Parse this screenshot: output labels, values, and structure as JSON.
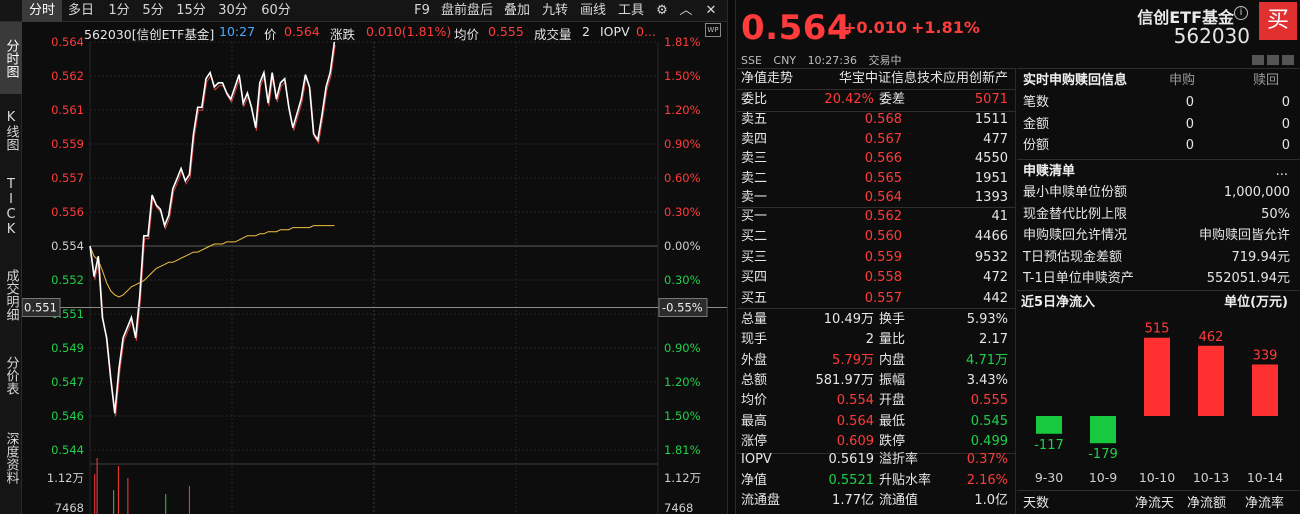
{
  "toolbar": {
    "tabs": [
      "分时",
      "多日",
      "1分",
      "5分",
      "15分",
      "30分",
      "60分"
    ],
    "right_items": [
      "F9",
      "盘前盘后",
      "叠加",
      "九转",
      "画线",
      "工具"
    ]
  },
  "vtabs": [
    "分时图",
    "K线图",
    "TICK",
    "成交明细",
    "分价表",
    "深度资料"
  ],
  "chart": {
    "code_name": "562030[信创ETF基金]",
    "time": "10:27",
    "price_label": "价",
    "price": "0.564",
    "change_label": "涨跌",
    "change": "0.010(1.81%)",
    "avg_label": "均价",
    "avg": "0.555",
    "vol_label": "成交量",
    "vol": "2",
    "iopv_label": "IOPV",
    "iopv": "0...",
    "wp": "WP",
    "y_left": [
      "0.564",
      "0.562",
      "0.561",
      "0.559",
      "0.557",
      "0.556",
      "0.554",
      "0.552",
      "0.551",
      "0.549",
      "0.547",
      "0.546",
      "0.544"
    ],
    "y_right": [
      "1.81%",
      "1.50%",
      "1.20%",
      "0.90%",
      "0.60%",
      "0.30%",
      "0.00%",
      "0.30%",
      "",
      "0.90%",
      "1.20%",
      "1.50%",
      "1.81%"
    ],
    "crosshair_left": "0.551",
    "crosshair_right": "-0.55%",
    "vol_left": [
      "1.12万",
      "7468"
    ],
    "vol_right": [
      "1.12万",
      "7468"
    ],
    "colors": {
      "price_line": "#ffffff",
      "avg_line": "#f0c040",
      "up": "#ff3b3b",
      "down": "#1fd14a"
    }
  },
  "chart_data": {
    "type": "line",
    "x": [
      0,
      1,
      2,
      3,
      4,
      5,
      6,
      7,
      8,
      9,
      10,
      11,
      12,
      13,
      14,
      15,
      16,
      17,
      18,
      19,
      20,
      21,
      22,
      23,
      24,
      25,
      26,
      27,
      28,
      29,
      30,
      31,
      32,
      33,
      34,
      35,
      36,
      37,
      38,
      39,
      40,
      41,
      42,
      43,
      44,
      45,
      46,
      47,
      48,
      49,
      50,
      51,
      52,
      53,
      54,
      55,
      56,
      57,
      58,
      59,
      60,
      61,
      62,
      63,
      64
    ],
    "series": [
      {
        "values": [
          0.554,
          0.5525,
          0.5535,
          0.5505,
          0.5495,
          0.5475,
          0.5458,
          0.548,
          0.5495,
          0.55,
          0.5505,
          0.5495,
          0.5515,
          0.5545,
          0.5545,
          0.5565,
          0.556,
          0.5558,
          0.555,
          0.5555,
          0.5568,
          0.5573,
          0.5578,
          0.5572,
          0.5575,
          0.5595,
          0.5608,
          0.5608,
          0.5622,
          0.5625,
          0.5618,
          0.562,
          0.562,
          0.5615,
          0.5612,
          0.5618,
          0.5624,
          0.561,
          0.5615,
          0.5608,
          0.5598,
          0.562,
          0.5625,
          0.561,
          0.5625,
          0.5612,
          0.562,
          0.5622,
          0.5608,
          0.5598,
          0.5605,
          0.5612,
          0.5624,
          0.5618,
          0.5595,
          0.5592,
          0.5604,
          0.5618,
          0.5625,
          0.564
        ]
      },
      {
        "values": [
          0.554,
          0.5535,
          0.5533,
          0.5528,
          0.5522,
          0.5518,
          0.5516,
          0.5515,
          0.5516,
          0.5518,
          0.552,
          0.5521,
          0.5522,
          0.5523,
          0.5525,
          0.5527,
          0.5529,
          0.553,
          0.5531,
          0.5532,
          0.5532,
          0.5533,
          0.5534,
          0.5535,
          0.5536,
          0.5537,
          0.5537,
          0.5538,
          0.5539,
          0.554,
          0.5541,
          0.5541,
          0.5541,
          0.5542,
          0.5542,
          0.5542,
          0.5543,
          0.5544,
          0.5545,
          0.5545,
          0.5545,
          0.5546,
          0.5546,
          0.5547,
          0.5547,
          0.5547,
          0.5548,
          0.5548,
          0.5548,
          0.5549,
          0.5549,
          0.5549,
          0.5549,
          0.5549,
          0.555,
          0.555,
          0.555,
          0.555,
          0.555,
          0.555
        ]
      }
    ],
    "ylim": [
      0.544,
      0.564
    ],
    "grid": true
  },
  "quote": {
    "price": "0.564",
    "change": "+0.010",
    "change_pct": "+1.81%",
    "exchange": "SSE",
    "currency": "CNY",
    "time": "10:27:36",
    "status": "交易中",
    "name": "信创ETF基金",
    "info": "i",
    "code": "562030",
    "buy": "买"
  },
  "book": {
    "nav_trend_label": "净值走势",
    "index_name": "华宝中证信息技术应用创新产",
    "weibi_label": "委比",
    "weibi": "20.42%",
    "weicha_label": "委差",
    "weicha": "5071",
    "asks": [
      {
        "label": "卖五",
        "price": "0.568",
        "vol": "1511"
      },
      {
        "label": "卖四",
        "price": "0.567",
        "vol": "477"
      },
      {
        "label": "卖三",
        "price": "0.566",
        "vol": "4550"
      },
      {
        "label": "卖二",
        "price": "0.565",
        "vol": "1951"
      },
      {
        "label": "卖一",
        "price": "0.564",
        "vol": "1393"
      }
    ],
    "bids": [
      {
        "label": "买一",
        "price": "0.562",
        "vol": "41"
      },
      {
        "label": "买二",
        "price": "0.560",
        "vol": "4466"
      },
      {
        "label": "买三",
        "price": "0.559",
        "vol": "9532"
      },
      {
        "label": "买四",
        "price": "0.558",
        "vol": "472"
      },
      {
        "label": "买五",
        "price": "0.557",
        "vol": "442"
      }
    ],
    "stats": [
      {
        "l1": "总量",
        "v1": "10.49万",
        "c1": "white",
        "l2": "换手",
        "v2": "5.93%",
        "c2": "white"
      },
      {
        "l1": "现手",
        "v1": "2",
        "c1": "white",
        "l2": "量比",
        "v2": "2.17",
        "c2": "white"
      },
      {
        "l1": "外盘",
        "v1": "5.79万",
        "c1": "red",
        "l2": "内盘",
        "v2": "4.71万",
        "c2": "green"
      },
      {
        "l1": "总额",
        "v1": "581.97万",
        "c1": "white",
        "l2": "振幅",
        "v2": "3.43%",
        "c2": "white"
      },
      {
        "l1": "均价",
        "v1": "0.554",
        "c1": "red",
        "l2": "开盘",
        "v2": "0.555",
        "c2": "red"
      },
      {
        "l1": "最高",
        "v1": "0.564",
        "c1": "red",
        "l2": "最低",
        "v2": "0.545",
        "c2": "green"
      },
      {
        "l1": "涨停",
        "v1": "0.609",
        "c1": "red",
        "l2": "跌停",
        "v2": "0.499",
        "c2": "green"
      }
    ],
    "stats2": [
      {
        "l1": "IOPV",
        "v1": "0.5619",
        "c1": "white",
        "l2": "溢折率",
        "v2": "0.37%",
        "c2": "red"
      },
      {
        "l1": "净值",
        "v1": "0.5521",
        "c1": "green",
        "l2": "升贴水率",
        "v2": "2.16%",
        "c2": "red"
      },
      {
        "l1": "流通盘",
        "v1": "1.77亿",
        "c1": "white",
        "l2": "流通值",
        "v2": "1.0亿",
        "c2": "white"
      }
    ]
  },
  "side": {
    "redeem_title": "实时申购赎回信息",
    "col_sub": "申购",
    "col_red": "赎回",
    "redeem_rows": [
      {
        "label": "笔数",
        "sub": "0",
        "red": "0"
      },
      {
        "label": "金额",
        "sub": "0",
        "red": "0"
      },
      {
        "label": "份额",
        "sub": "0",
        "red": "0"
      }
    ],
    "list_title": "申赎清单",
    "more": "...",
    "list_rows": [
      {
        "label": "最小申赎单位份额",
        "value": "1,000,000"
      },
      {
        "label": "现金替代比例上限",
        "value": "50%"
      },
      {
        "label": "申购赎回允许情况",
        "value": "申购赎回皆允许"
      },
      {
        "label": "T日预估现金差额",
        "value": "719.94元"
      },
      {
        "label": "T-1日单位申赎资产",
        "value": "552051.94元"
      }
    ],
    "flow_title": "近5日净流入",
    "flow_unit": "单位(万元)",
    "flow_dates": [
      "9-30",
      "10-9",
      "10-10",
      "10-13",
      "10-14"
    ],
    "flow_values": [
      -117,
      -179,
      515,
      462,
      339
    ],
    "flow_labels": [
      "-117",
      "-179",
      "515",
      "462",
      "339"
    ],
    "footer": [
      "天数",
      "净流天",
      "净流额",
      "净流率"
    ]
  }
}
